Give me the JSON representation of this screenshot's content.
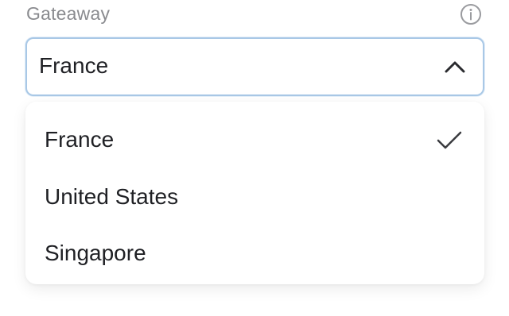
{
  "field": {
    "label": "Gateaway",
    "info_icon": "info-circle-icon"
  },
  "select": {
    "value": "France",
    "expanded": true,
    "chevron_icon": "chevron-up-icon"
  },
  "dropdown": {
    "options": [
      {
        "label": "France",
        "selected": true
      },
      {
        "label": "United States",
        "selected": false
      },
      {
        "label": "Singapore",
        "selected": false
      }
    ],
    "check_icon": "checkmark-icon"
  },
  "colors": {
    "focus_border": "#a9c8e6",
    "label": "#8a8b8f",
    "text": "#1f2024"
  }
}
